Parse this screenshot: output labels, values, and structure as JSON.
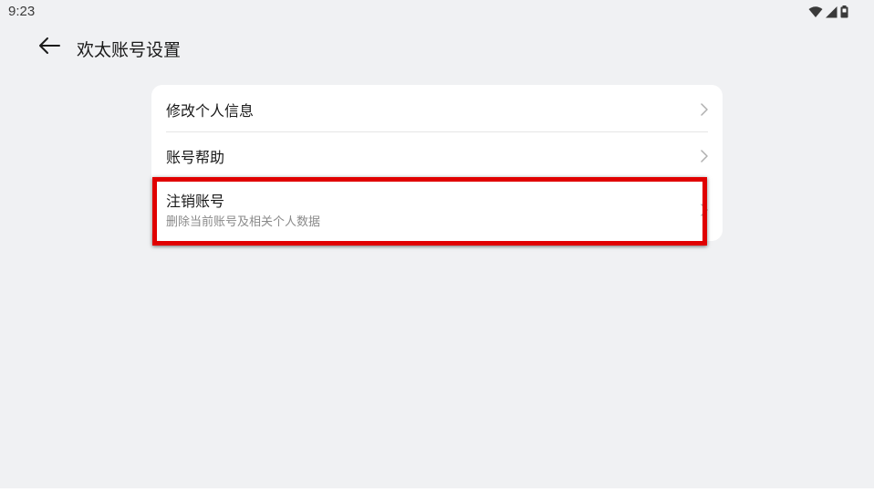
{
  "status_bar": {
    "time": "9:23",
    "icons": [
      "wifi-icon",
      "cellular-signal-icon",
      "battery-icon"
    ]
  },
  "header": {
    "back_icon": "arrow-left-icon",
    "title": "欢太账号设置"
  },
  "settings": {
    "items": [
      {
        "label": "修改个人信息",
        "icon": "chevron-right-icon"
      },
      {
        "label": "账号帮助",
        "icon": "chevron-right-icon"
      },
      {
        "label": "注销账号",
        "subtitle": "删除当前账号及相关个人数据",
        "icon": "chevron-right-icon"
      }
    ]
  },
  "colors": {
    "background": "#f0f1f3",
    "card": "#ffffff",
    "highlight": "#e00000",
    "secondary_text": "#8a8a8a"
  }
}
